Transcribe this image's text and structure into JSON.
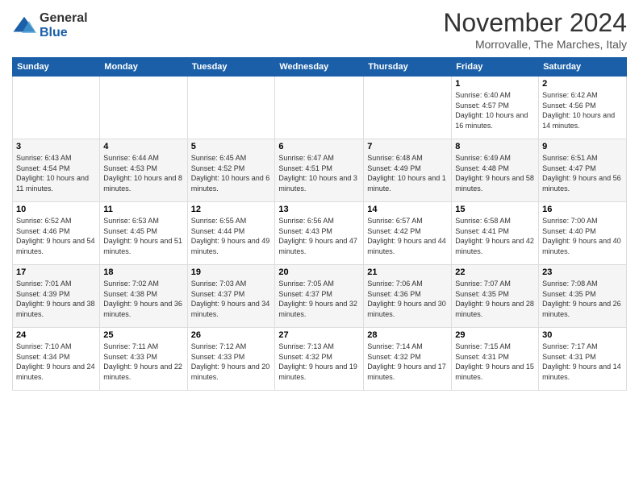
{
  "header": {
    "logo_line1": "General",
    "logo_line2": "Blue",
    "month_title": "November 2024",
    "subtitle": "Morrovalle, The Marches, Italy"
  },
  "weekdays": [
    "Sunday",
    "Monday",
    "Tuesday",
    "Wednesday",
    "Thursday",
    "Friday",
    "Saturday"
  ],
  "weeks": [
    [
      {
        "day": "",
        "info": ""
      },
      {
        "day": "",
        "info": ""
      },
      {
        "day": "",
        "info": ""
      },
      {
        "day": "",
        "info": ""
      },
      {
        "day": "",
        "info": ""
      },
      {
        "day": "1",
        "info": "Sunrise: 6:40 AM\nSunset: 4:57 PM\nDaylight: 10 hours and 16 minutes."
      },
      {
        "day": "2",
        "info": "Sunrise: 6:42 AM\nSunset: 4:56 PM\nDaylight: 10 hours and 14 minutes."
      }
    ],
    [
      {
        "day": "3",
        "info": "Sunrise: 6:43 AM\nSunset: 4:54 PM\nDaylight: 10 hours and 11 minutes."
      },
      {
        "day": "4",
        "info": "Sunrise: 6:44 AM\nSunset: 4:53 PM\nDaylight: 10 hours and 8 minutes."
      },
      {
        "day": "5",
        "info": "Sunrise: 6:45 AM\nSunset: 4:52 PM\nDaylight: 10 hours and 6 minutes."
      },
      {
        "day": "6",
        "info": "Sunrise: 6:47 AM\nSunset: 4:51 PM\nDaylight: 10 hours and 3 minutes."
      },
      {
        "day": "7",
        "info": "Sunrise: 6:48 AM\nSunset: 4:49 PM\nDaylight: 10 hours and 1 minute."
      },
      {
        "day": "8",
        "info": "Sunrise: 6:49 AM\nSunset: 4:48 PM\nDaylight: 9 hours and 58 minutes."
      },
      {
        "day": "9",
        "info": "Sunrise: 6:51 AM\nSunset: 4:47 PM\nDaylight: 9 hours and 56 minutes."
      }
    ],
    [
      {
        "day": "10",
        "info": "Sunrise: 6:52 AM\nSunset: 4:46 PM\nDaylight: 9 hours and 54 minutes."
      },
      {
        "day": "11",
        "info": "Sunrise: 6:53 AM\nSunset: 4:45 PM\nDaylight: 9 hours and 51 minutes."
      },
      {
        "day": "12",
        "info": "Sunrise: 6:55 AM\nSunset: 4:44 PM\nDaylight: 9 hours and 49 minutes."
      },
      {
        "day": "13",
        "info": "Sunrise: 6:56 AM\nSunset: 4:43 PM\nDaylight: 9 hours and 47 minutes."
      },
      {
        "day": "14",
        "info": "Sunrise: 6:57 AM\nSunset: 4:42 PM\nDaylight: 9 hours and 44 minutes."
      },
      {
        "day": "15",
        "info": "Sunrise: 6:58 AM\nSunset: 4:41 PM\nDaylight: 9 hours and 42 minutes."
      },
      {
        "day": "16",
        "info": "Sunrise: 7:00 AM\nSunset: 4:40 PM\nDaylight: 9 hours and 40 minutes."
      }
    ],
    [
      {
        "day": "17",
        "info": "Sunrise: 7:01 AM\nSunset: 4:39 PM\nDaylight: 9 hours and 38 minutes."
      },
      {
        "day": "18",
        "info": "Sunrise: 7:02 AM\nSunset: 4:38 PM\nDaylight: 9 hours and 36 minutes."
      },
      {
        "day": "19",
        "info": "Sunrise: 7:03 AM\nSunset: 4:37 PM\nDaylight: 9 hours and 34 minutes."
      },
      {
        "day": "20",
        "info": "Sunrise: 7:05 AM\nSunset: 4:37 PM\nDaylight: 9 hours and 32 minutes."
      },
      {
        "day": "21",
        "info": "Sunrise: 7:06 AM\nSunset: 4:36 PM\nDaylight: 9 hours and 30 minutes."
      },
      {
        "day": "22",
        "info": "Sunrise: 7:07 AM\nSunset: 4:35 PM\nDaylight: 9 hours and 28 minutes."
      },
      {
        "day": "23",
        "info": "Sunrise: 7:08 AM\nSunset: 4:35 PM\nDaylight: 9 hours and 26 minutes."
      }
    ],
    [
      {
        "day": "24",
        "info": "Sunrise: 7:10 AM\nSunset: 4:34 PM\nDaylight: 9 hours and 24 minutes."
      },
      {
        "day": "25",
        "info": "Sunrise: 7:11 AM\nSunset: 4:33 PM\nDaylight: 9 hours and 22 minutes."
      },
      {
        "day": "26",
        "info": "Sunrise: 7:12 AM\nSunset: 4:33 PM\nDaylight: 9 hours and 20 minutes."
      },
      {
        "day": "27",
        "info": "Sunrise: 7:13 AM\nSunset: 4:32 PM\nDaylight: 9 hours and 19 minutes."
      },
      {
        "day": "28",
        "info": "Sunrise: 7:14 AM\nSunset: 4:32 PM\nDaylight: 9 hours and 17 minutes."
      },
      {
        "day": "29",
        "info": "Sunrise: 7:15 AM\nSunset: 4:31 PM\nDaylight: 9 hours and 15 minutes."
      },
      {
        "day": "30",
        "info": "Sunrise: 7:17 AM\nSunset: 4:31 PM\nDaylight: 9 hours and 14 minutes."
      }
    ]
  ]
}
